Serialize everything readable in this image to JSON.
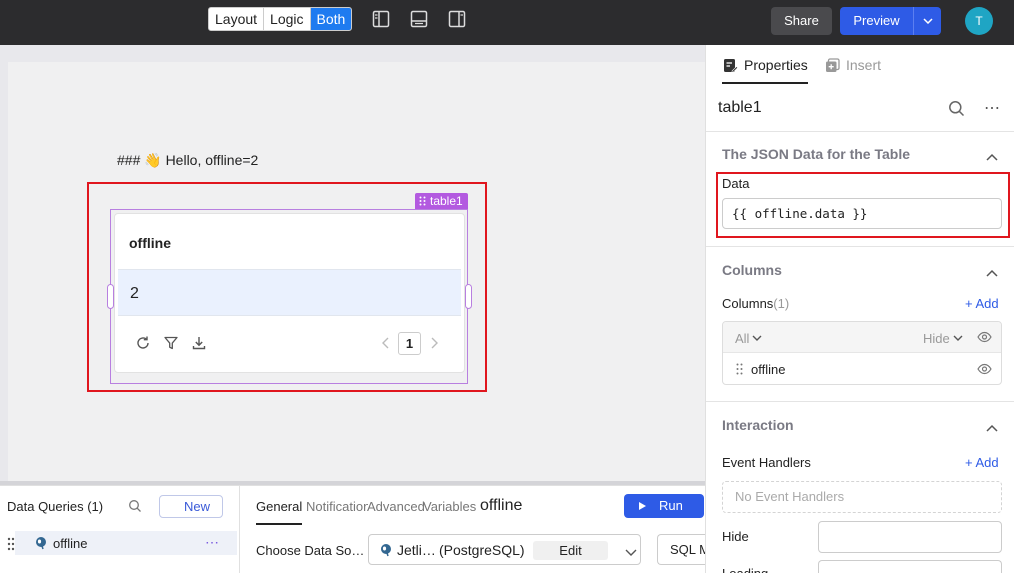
{
  "topbar": {
    "modes": [
      "Layout",
      "Logic",
      "Both"
    ],
    "active_mode": "Both",
    "share_label": "Share",
    "preview_label": "Preview",
    "avatar_initial": "T",
    "colors": {
      "bar_bg": "#2c2c2e",
      "accent": "#2e5be6",
      "mode_active": "#1e7bf0"
    }
  },
  "canvas": {
    "markdown_text": "### 👋 Hello, offline=2",
    "table": {
      "tag_label": "table1",
      "column_header": "offline",
      "rows": [
        [
          "2"
        ]
      ],
      "current_page": "1"
    }
  },
  "queries": {
    "title": "Data Queries (1)",
    "new_label": "New",
    "items": [
      {
        "name": "offline"
      }
    ],
    "tabs": [
      "General",
      "Notification",
      "Advanced",
      "Variables"
    ],
    "active_tab": "General",
    "query_name": "offline",
    "run_label": "Run",
    "choose_label": "Choose Data So…",
    "datasource_name": "Jetli…",
    "datasource_type": "(PostgreSQL)",
    "edit_label": "Edit",
    "sql_mode_label": "SQL M"
  },
  "properties": {
    "tabs": [
      "Properties",
      "Insert"
    ],
    "component_name": "table1",
    "data_section": {
      "title": "The JSON Data for the Table",
      "field_label": "Data",
      "value": "{{ offline.data }}"
    },
    "columns_section": {
      "title": "Columns",
      "label": "Columns",
      "count": "(1)",
      "add_label": "+ Add",
      "filter_all": "All",
      "filter_hide": "Hide",
      "items": [
        "offline"
      ]
    },
    "interaction_section": {
      "title": "Interaction",
      "event_handlers_label": "Event Handlers",
      "add_label": "+ Add",
      "empty_text": "No Event Handlers",
      "hide_label": "Hide",
      "loading_label": "Loading"
    }
  }
}
